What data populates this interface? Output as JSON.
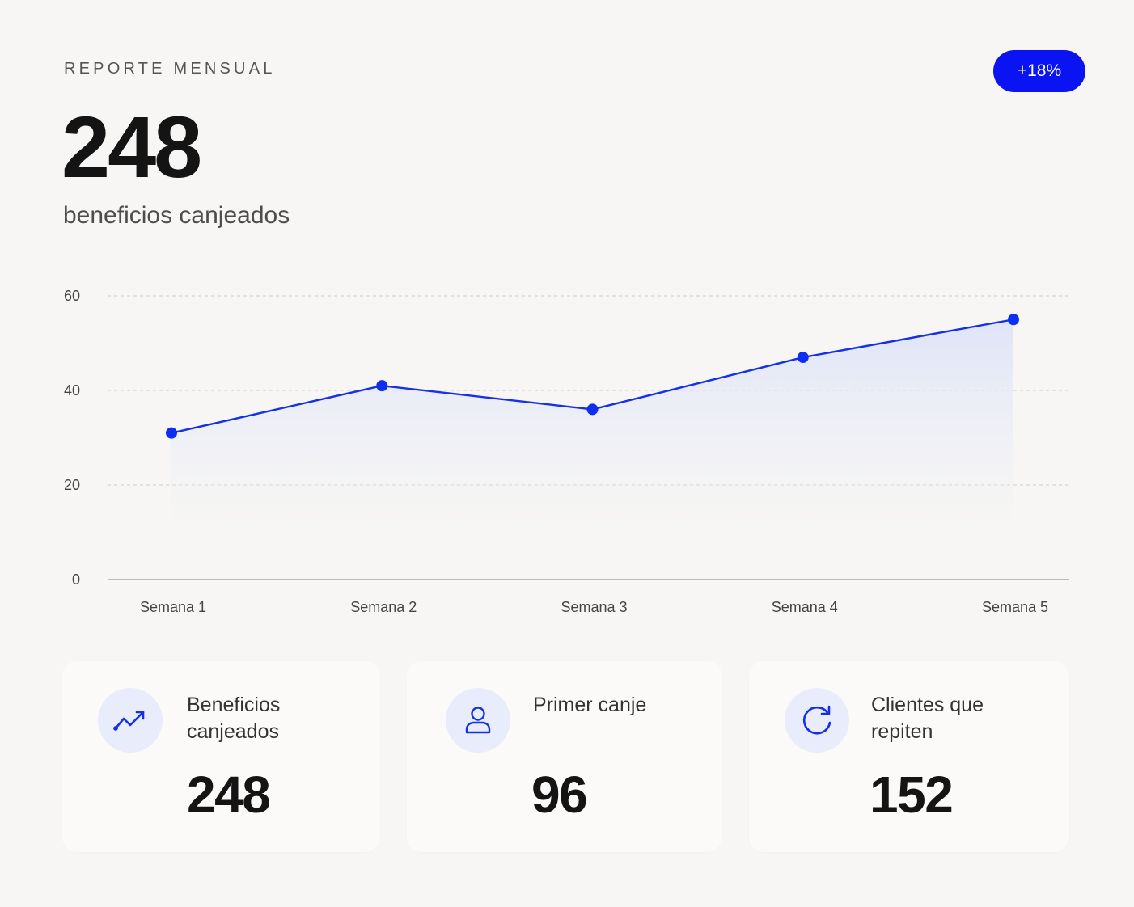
{
  "header": {
    "kicker": "REPORTE MENSUAL",
    "badge": "+18%",
    "hero_value": "248",
    "hero_label": "beneficios canjeados"
  },
  "colors": {
    "accent": "#0a14f2",
    "line": "#1530e6",
    "point": "#0f2ff0",
    "area": "#dfe4f7",
    "icon_bg": "#e9edfb"
  },
  "chart_data": {
    "type": "area",
    "categories": [
      "Semana 1",
      "Semana 2",
      "Semana 3",
      "Semana 4",
      "Semana 5"
    ],
    "values": [
      31,
      41,
      36,
      47,
      55
    ],
    "ylim": [
      0,
      60
    ],
    "yticks": [
      0,
      20,
      40,
      60
    ],
    "grid": true
  },
  "cards": [
    {
      "icon": "trending-up-icon",
      "label": "Beneficios canjeados",
      "value": "248"
    },
    {
      "icon": "user-icon",
      "label": "Primer canje",
      "value": "96"
    },
    {
      "icon": "refresh-icon",
      "label": "Clientes que repiten",
      "value": "152"
    }
  ]
}
